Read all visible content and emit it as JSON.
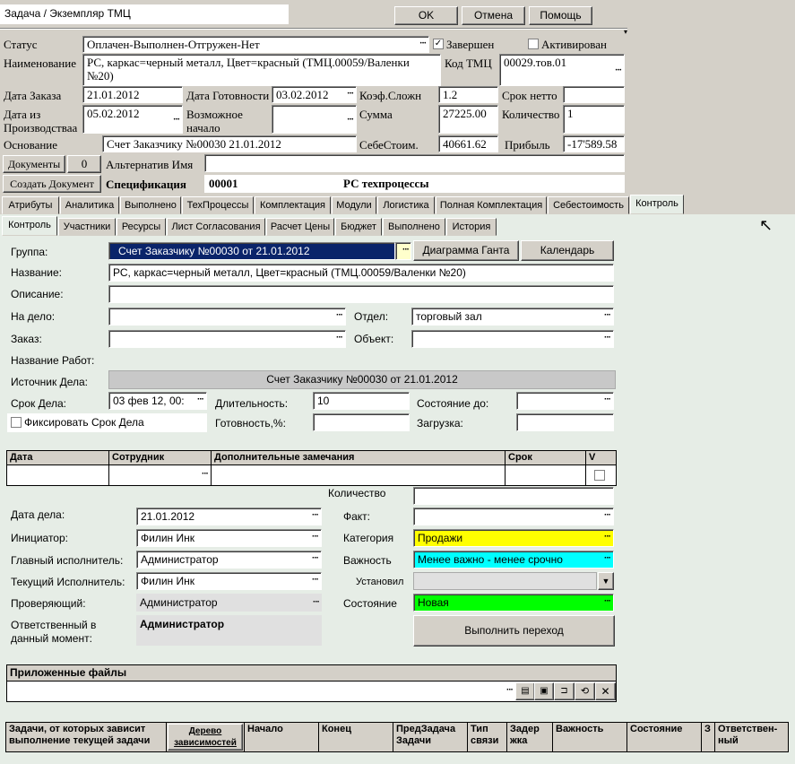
{
  "window": {
    "title": "Задача / Экземпляр ТМЦ",
    "ok": "OK",
    "cancel": "Отмена",
    "help": "Помощь"
  },
  "header": {
    "status_label": "Статус",
    "status_value": "Оплачен-Выполнен-Отгружен-Нет",
    "done_label": "Завершен",
    "active_label": "Активирован",
    "name_label": "Наименование",
    "name_value": "РС, каркас=черный металл, Цвет=красный  (ТМЦ.00059/Валенки №20)",
    "code_label": "Код ТМЦ",
    "code_value": "00029.тов.01",
    "order_date_label": "Дата Заказа",
    "order_date_value": "21.01.2012",
    "ready_date_label": "Дата Готовности",
    "ready_date_value": "03.02.2012",
    "coef_label": "Коэф.Сложн",
    "coef_value": "1.2",
    "term_label": "Срок нетто",
    "term_value": "",
    "from_prod_label": "Дата из Производстваа",
    "from_prod_value": "05.02.2012",
    "possible_start_label": "Возможное начало",
    "possible_start_value": "",
    "sum_label": "Сумма",
    "sum_value": "27225.00",
    "qty_label": "Количество",
    "qty_value": "1",
    "basis_label": "Основание",
    "basis_value": "Счет Заказчику №00030 21.01.2012",
    "cost_label": "СебеСтоим.",
    "cost_value": "40661.62",
    "profit_label": "Прибыль",
    "profit_value": "-17'589.58",
    "docs_button": "Документы",
    "docs_count": "0",
    "alt_name_label": "Альтернатив Имя",
    "alt_name_value": "",
    "create_doc_button": "Создать Документ",
    "spec_label": "Спецификация",
    "spec_value": "00001",
    "spec_name": "РС техпроцессы"
  },
  "tabs1": [
    "Атрибуты",
    "Аналитика",
    "Выполнено",
    "ТехПроцессы",
    "Комплектация",
    "Модули",
    "Логистика",
    "Полная Комплектация",
    "Себестоимость",
    "Контроль"
  ],
  "tabs2": [
    "Контроль",
    "Участники",
    "Ресурсы",
    "Лист Согласования",
    "Расчет Цены",
    "Бюджет",
    "Выполнено",
    "История"
  ],
  "control": {
    "group_label": "Группа:",
    "group_value": "Счет Заказчику №00030 от 21.01.2012",
    "gantt_button": "Диаграмма Ганта",
    "calendar_button": "Календарь",
    "title_label": "Название:",
    "title_value": "РС, каркас=черный металл, Цвет=красный  (ТМЦ.00059/Валенки №20)",
    "desc_label": "Описание:",
    "desc_value": "",
    "for_case_label": "На дело:",
    "for_case_value": "",
    "dept_label": "Отдел:",
    "dept_value": "торговый зал",
    "order_label": "Заказ:",
    "order_value": "",
    "object_label": "Объект:",
    "object_value": "",
    "work_name_label": "Название Работ:",
    "work_name_value": "",
    "source_label": "Источник Дела:",
    "source_value": "Счет Заказчику №00030 от 21.01.2012",
    "deadline_label": "Срок Дела:",
    "deadline_value": "03 фев 12, 00:",
    "duration_label": "Длительность:",
    "duration_value": "10",
    "state_to_label": "Состояние до:",
    "state_to_value": "",
    "fix_label": "Фиксировать Срок Дела",
    "readiness_label": "Готовность,%:",
    "readiness_value": "",
    "load_label": "Загрузка:",
    "load_value": ""
  },
  "notes_table": {
    "headers": [
      "Дата",
      "Сотрудник",
      "Дополнительные замечания",
      "Срок",
      "V"
    ]
  },
  "details": {
    "qty_label": "Количество",
    "qty_value": "",
    "case_date_label": "Дата дела:",
    "case_date_value": "21.01.2012",
    "fact_label": "Факт:",
    "fact_value": "",
    "initiator_label": "Инициатор:",
    "initiator_value": "Филин Инк",
    "category_label": "Категория",
    "category_value": "Продажи",
    "main_exec_label": "Главный исполнитель:",
    "main_exec_value": "Администратор",
    "importance_label": "Важность",
    "importance_value": "Менее важно - менее срочно",
    "cur_exec_label": "Текущий Исполнитель:",
    "cur_exec_value": "Филин Инк",
    "set_label": "Установил",
    "set_value": "",
    "checker_label": "Проверяющий:",
    "checker_value": "Администратор",
    "state_label": "Состояние",
    "state_value": "Новая",
    "responsible_label": "Ответственный в данный момент:",
    "responsible_value": "Администратор",
    "transition_button": "Выполнить переход",
    "category_color": "#ffff00",
    "importance_color": "#00ffff",
    "state_color": "#00ff00"
  },
  "files": {
    "label": "Приложенные файлы",
    "value": ""
  },
  "deps_table": {
    "headers": [
      "Задачи, от которых зависит выполнение текущей задачи",
      "Дерево зависимостей",
      "Начало",
      "Конец",
      "ПредЗадача Задачи",
      "Тип связи",
      "Задер жка",
      "Важность",
      "Состояние",
      "З",
      "Ответствен-ный"
    ]
  }
}
